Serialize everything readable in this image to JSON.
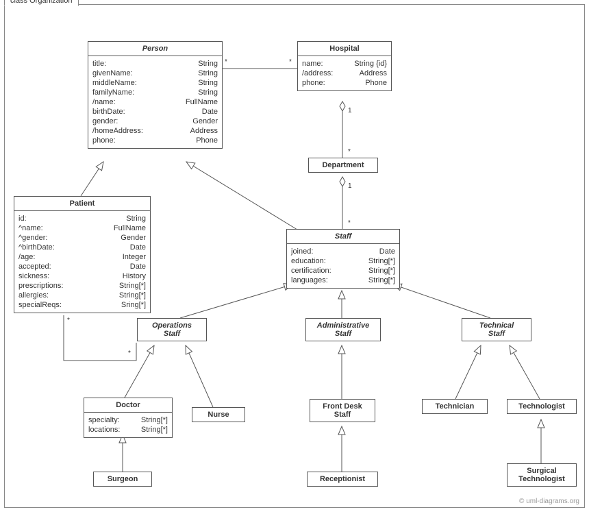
{
  "frame": {
    "title": "class Organization"
  },
  "credit": "© uml-diagrams.org",
  "classes": {
    "person": {
      "name": "Person",
      "attrs": [
        {
          "n": "title:",
          "t": "String"
        },
        {
          "n": "givenName:",
          "t": "String"
        },
        {
          "n": "middleName:",
          "t": "String"
        },
        {
          "n": "familyName:",
          "t": "String"
        },
        {
          "n": "/name:",
          "t": "FullName"
        },
        {
          "n": "birthDate:",
          "t": "Date"
        },
        {
          "n": "gender:",
          "t": "Gender"
        },
        {
          "n": "/homeAddress:",
          "t": "Address"
        },
        {
          "n": "phone:",
          "t": "Phone"
        }
      ]
    },
    "hospital": {
      "name": "Hospital",
      "attrs": [
        {
          "n": "name:",
          "t": "String {id}"
        },
        {
          "n": "/address:",
          "t": "Address"
        },
        {
          "n": "phone:",
          "t": "Phone"
        }
      ]
    },
    "department": {
      "name": "Department"
    },
    "patient": {
      "name": "Patient",
      "attrs": [
        {
          "n": "id:",
          "t": "String"
        },
        {
          "n": "^name:",
          "t": "FullName"
        },
        {
          "n": "^gender:",
          "t": "Gender"
        },
        {
          "n": "^birthDate:",
          "t": "Date"
        },
        {
          "n": "/age:",
          "t": "Integer"
        },
        {
          "n": "accepted:",
          "t": "Date"
        },
        {
          "n": "sickness:",
          "t": "History"
        },
        {
          "n": "prescriptions:",
          "t": "String[*]"
        },
        {
          "n": "allergies:",
          "t": "String[*]"
        },
        {
          "n": "specialReqs:",
          "t": "Sring[*]"
        }
      ]
    },
    "staff": {
      "name": "Staff",
      "attrs": [
        {
          "n": "joined:",
          "t": "Date"
        },
        {
          "n": "education:",
          "t": "String[*]"
        },
        {
          "n": "certification:",
          "t": "String[*]"
        },
        {
          "n": "languages:",
          "t": "String[*]"
        }
      ]
    },
    "opsStaff": {
      "name": "Operations",
      "name2": "Staff"
    },
    "adminStaff": {
      "name": "Administrative",
      "name2": "Staff"
    },
    "techStaff": {
      "name": "Technical",
      "name2": "Staff"
    },
    "doctor": {
      "name": "Doctor",
      "attrs": [
        {
          "n": "specialty:",
          "t": "String[*]"
        },
        {
          "n": "locations:",
          "t": "String[*]"
        }
      ]
    },
    "nurse": {
      "name": "Nurse"
    },
    "frontDesk": {
      "name": "Front Desk",
      "name2": "Staff"
    },
    "technician": {
      "name": "Technician"
    },
    "technologist": {
      "name": "Technologist"
    },
    "surgeon": {
      "name": "Surgeon"
    },
    "receptionist": {
      "name": "Receptionist"
    },
    "surgTech": {
      "name": "Surgical",
      "name2": "Technologist"
    }
  },
  "mults": {
    "personHosp_p": "*",
    "personHosp_h": "*",
    "hospDept_h": "1",
    "hospDept_d": "*",
    "deptStaff_d": "1",
    "deptStaff_s": "*",
    "patOps_p": "*",
    "patOps_o": "*"
  }
}
